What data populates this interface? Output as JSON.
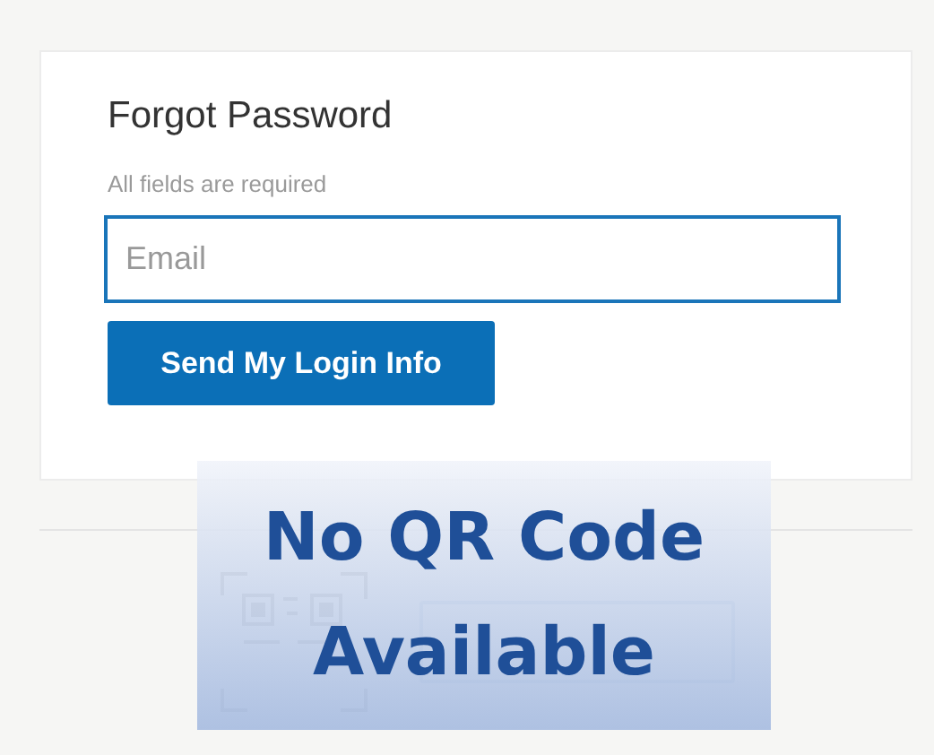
{
  "form": {
    "title": "Forgot Password",
    "note": "All fields are required",
    "email": {
      "placeholder": "Email"
    },
    "submit": "Send My Login Info"
  },
  "overlay": {
    "message": "No QR Code Available"
  }
}
